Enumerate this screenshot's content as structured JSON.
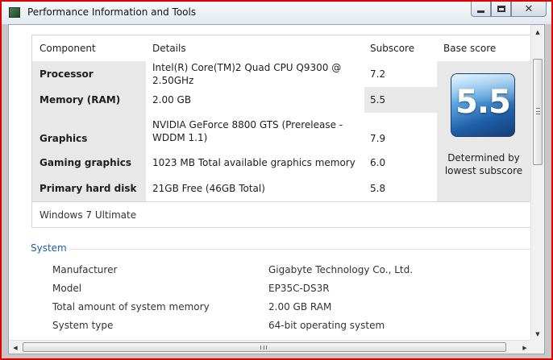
{
  "window": {
    "title": "Performance Information and Tools",
    "close_glyph": "✕"
  },
  "table": {
    "headers": {
      "component": "Component",
      "details": "Details",
      "subscore": "Subscore",
      "base_score": "Base score"
    },
    "rows": [
      {
        "component": "Processor",
        "details": "Intel(R) Core(TM)2 Quad CPU Q9300 @ 2.50GHz",
        "subscore": "7.2"
      },
      {
        "component": "Memory (RAM)",
        "details": "2.00 GB",
        "subscore": "5.5"
      },
      {
        "component": "Graphics",
        "details": "NVIDIA GeForce 8800 GTS (Prerelease - WDDM 1.1)",
        "subscore": "7.9"
      },
      {
        "component": "Gaming graphics",
        "details": "1023 MB Total available graphics memory",
        "subscore": "6.0"
      },
      {
        "component": "Primary hard disk",
        "details": "21GB Free (46GB Total)",
        "subscore": "5.8"
      }
    ],
    "base_score": "5.5",
    "base_caption": "Determined by lowest subscore",
    "edition": "Windows 7 Ultimate"
  },
  "system": {
    "title": "System",
    "rows": [
      {
        "label": "Manufacturer",
        "value": "Gigabyte Technology Co., Ltd."
      },
      {
        "label": "Model",
        "value": "EP35C-DS3R"
      },
      {
        "label": "Total amount of system memory",
        "value": "2.00 GB RAM"
      },
      {
        "label": "System type",
        "value": "64-bit operating system"
      }
    ]
  },
  "scrollbars": {
    "up": "▲",
    "down": "▼",
    "left": "◀",
    "right": "▶"
  },
  "colors": {
    "accent": "#1f5fa6",
    "frame": "#e00000",
    "highlight": "#e8e8e8"
  }
}
